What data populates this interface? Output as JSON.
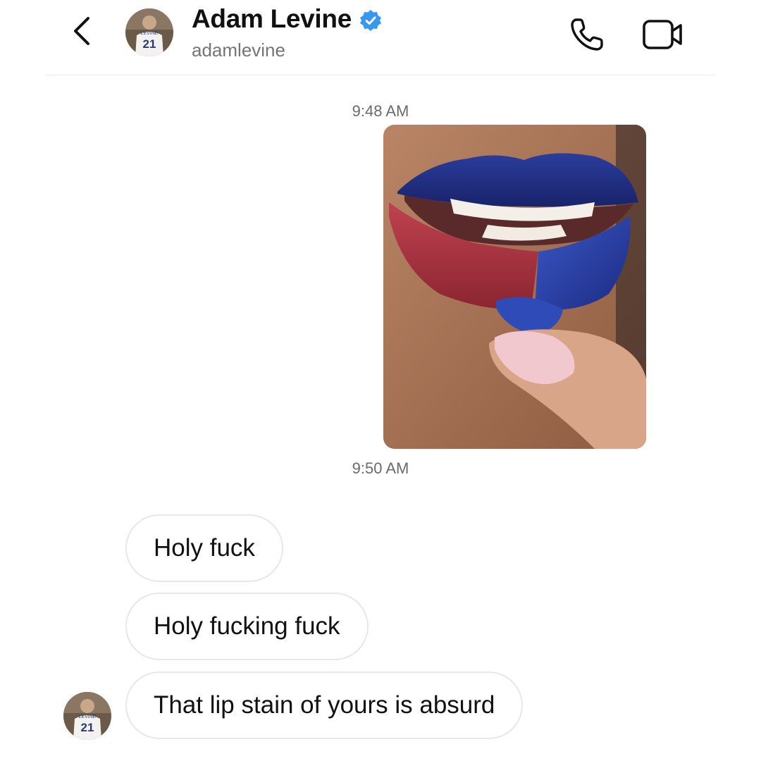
{
  "header": {
    "title": "Adam Levine",
    "handle": "adamlevine",
    "back_icon": "chevron-left-icon",
    "verified_icon": "verified-badge-icon",
    "call_icon": "phone-icon",
    "video_icon": "video-camera-icon",
    "accent_color": "#3897f0"
  },
  "messages": {
    "timestamp_1": "9:48 AM",
    "timestamp_2": "9:50 AM",
    "bubble_1": "Holy fuck",
    "bubble_2": "Holy fucking fuck",
    "bubble_3": "That lip stain of yours is absurd"
  },
  "jersey": {
    "number": "21",
    "name": "LEVINE"
  }
}
